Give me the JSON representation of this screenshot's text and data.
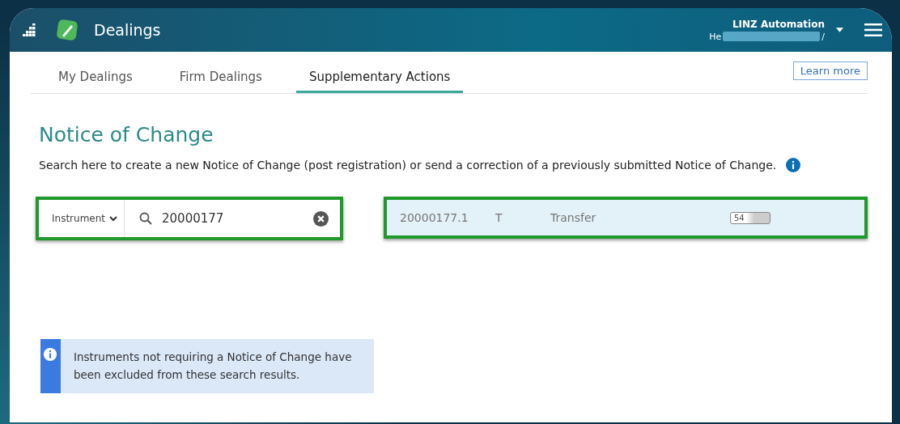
{
  "app_bar": {
    "title": "Dealings",
    "org": "LINZ Automation",
    "user_start": "He",
    "user_end": "/"
  },
  "tabs": [
    {
      "label": "My Dealings",
      "selected": false
    },
    {
      "label": "Firm Dealings",
      "selected": false
    },
    {
      "label": "Supplementary Actions",
      "selected": true
    }
  ],
  "learn_more": "Learn more",
  "heading": "Notice of Change",
  "description": "Search here to create a new Notice of Change (post registration) or send a correction of a previously submitted Notice of Change.",
  "search": {
    "type": "Instrument",
    "value": "20000177",
    "highlighted": true
  },
  "results": [
    {
      "instrument": "20000177.1",
      "code": "T",
      "type": "Transfer",
      "badge": "54",
      "highlighted": true
    }
  ],
  "info": "Instruments not requiring a Notice of Change have been excluded from these search results."
}
